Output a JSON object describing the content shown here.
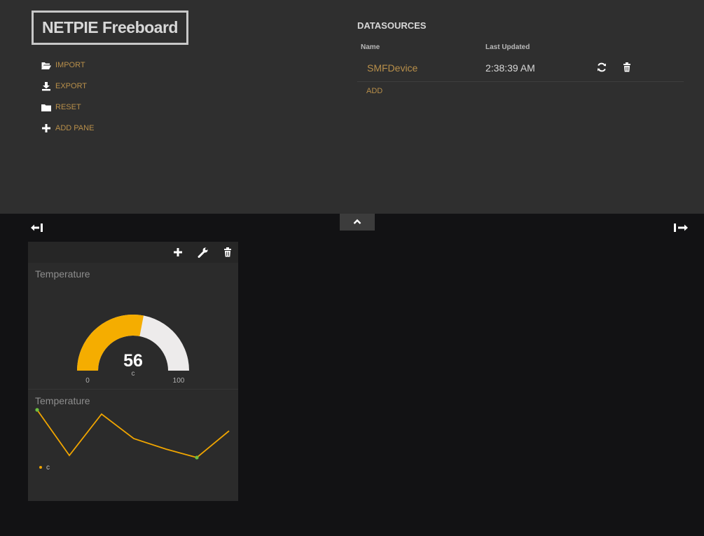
{
  "header": {
    "logo": "NETPIE Freeboard",
    "menu": [
      {
        "label": "IMPORT",
        "icon": "folder-open-icon"
      },
      {
        "label": "EXPORT",
        "icon": "download-icon"
      },
      {
        "label": "RESET",
        "icon": "folder-icon"
      },
      {
        "label": "ADD PANE",
        "icon": "plus-icon"
      }
    ]
  },
  "datasources": {
    "title": "DATASOURCES",
    "col_name": "Name",
    "col_updated": "Last Updated",
    "rows": [
      {
        "name": "SMFDevice",
        "updated": "2:38:39 AM"
      }
    ],
    "add_label": "ADD"
  },
  "pane": {
    "gauge": {
      "title": "Temperature",
      "value": "56",
      "unit": "c",
      "min": "0",
      "max": "100",
      "fill_fraction": 0.56
    },
    "sparkline": {
      "title": "Temperature",
      "legend": "c"
    }
  },
  "colors": {
    "accent": "#b88f4a",
    "gauge_fill": "#f5ad00",
    "gauge_track": "#edebeb",
    "line": "#f0a500",
    "point": "#6dbf3f"
  }
}
